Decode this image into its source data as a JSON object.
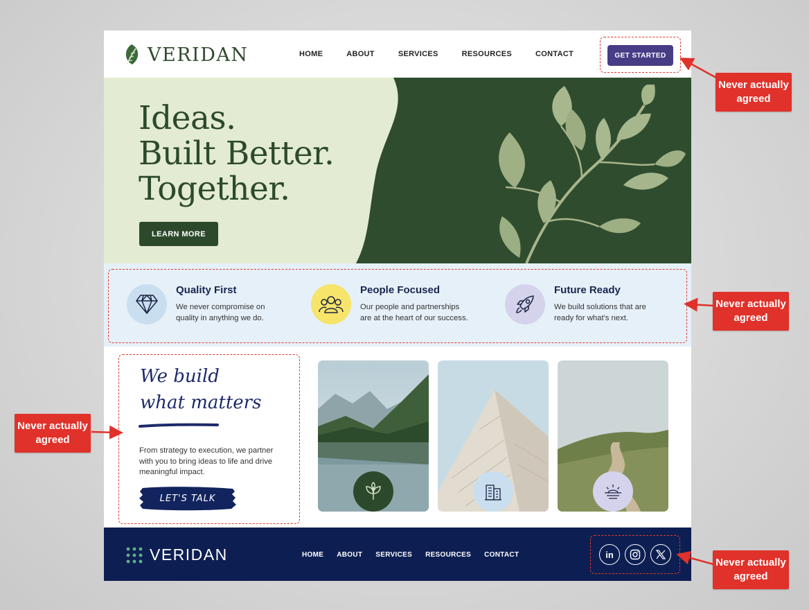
{
  "brand": {
    "name": "VERIDAN"
  },
  "header": {
    "nav": [
      "HOME",
      "ABOUT",
      "SERVICES",
      "RESOURCES",
      "CONTACT"
    ],
    "cta_label": "GET STARTED"
  },
  "hero": {
    "title_lines": [
      "Ideas.",
      "Built Better.",
      "Together."
    ],
    "button_label": "LEARN MORE"
  },
  "features": [
    {
      "title": "Quality First",
      "desc": [
        "We never compromise on",
        "quality in anything we do."
      ],
      "icon": "diamond-icon",
      "color": "#c9dff0"
    },
    {
      "title": "People Focused",
      "desc": [
        "Our people and partnerships",
        "are at the heart of our success."
      ],
      "icon": "people-icon",
      "color": "#f6e46b"
    },
    {
      "title": "Future Ready",
      "desc": [
        "We build solutions that are",
        "ready for what's next."
      ],
      "icon": "rocket-icon",
      "color": "#d5d3ec"
    }
  ],
  "about": {
    "script_lines": [
      "We build",
      "what matters"
    ],
    "text": "From strategy to execution, we partner with you to bring ideas to life and drive meaningful impact.",
    "button_label": "LET'S TALK"
  },
  "photos": [
    {
      "name": "mountain-lake-photo",
      "badge_icon": "leaf-icon"
    },
    {
      "name": "building-photo",
      "badge_icon": "building-icon"
    },
    {
      "name": "meadow-path-photo",
      "badge_icon": "sunrise-icon"
    }
  ],
  "footer": {
    "nav": [
      "HOME",
      "ABOUT",
      "SERVICES",
      "RESOURCES",
      "CONTACT"
    ],
    "social": [
      {
        "name": "linkedin-icon",
        "glyph": "in"
      },
      {
        "name": "instagram-icon",
        "glyph": ""
      },
      {
        "name": "x-icon",
        "glyph": ""
      }
    ]
  },
  "annotations": [
    "Never actually\nagreed",
    "Never actually\nagreed",
    "Never actually\nagreed",
    "Never actually\nagreed"
  ],
  "colors": {
    "primary_green": "#2c4a2b",
    "hero_bg": "#e3ebd2",
    "cta_purple": "#473d86",
    "footer_navy": "#0d1f52",
    "features_bg": "#e6f0f8",
    "annotation_red": "#e0312a"
  }
}
